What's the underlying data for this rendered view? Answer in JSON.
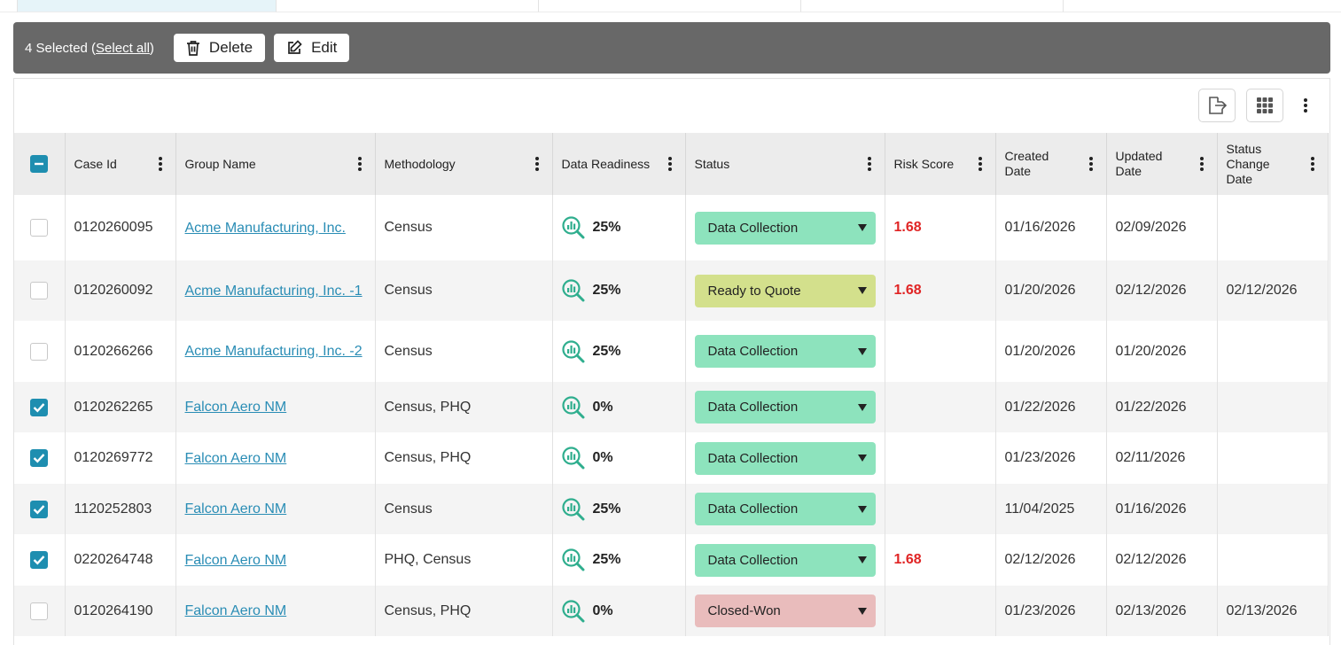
{
  "selection_bar": {
    "count_text": "4 Selected (",
    "select_all_label": "Select all",
    "close_paren": ")",
    "delete_label": "Delete",
    "edit_label": "Edit"
  },
  "icons": {
    "export": "export-icon",
    "columns": "grid-icon",
    "more": "kebab-icon"
  },
  "colors": {
    "selection_bar": "#686868",
    "checkbox_on": "#1e8eb0",
    "link": "#2a8db5",
    "risk": "#e02424",
    "status_data_collection": "#8de3bd",
    "status_ready_to_quote": "#d3e08c",
    "status_closed_won": "#e9bcbc"
  },
  "table": {
    "columns": [
      "Case Id",
      "Group Name",
      "Methodology",
      "Data Readiness",
      "Status",
      "Risk Score",
      "Created Date",
      "Updated Date",
      "Status Change Date"
    ],
    "rows": [
      {
        "checked": false,
        "case_id": "0120260095",
        "group": "Acme Manufacturing, Inc.",
        "methodology": "Census",
        "readiness": "25%",
        "status": "Data Collection",
        "risk": "1.68",
        "created": "01/16/2026",
        "updated": "02/09/2026",
        "status_change": ""
      },
      {
        "checked": false,
        "case_id": "0120260092",
        "group": "Acme Manufacturing, Inc. -1",
        "methodology": "Census",
        "readiness": "25%",
        "status": "Ready to Quote",
        "risk": "1.68",
        "created": "01/20/2026",
        "updated": "02/12/2026",
        "status_change": "02/12/2026"
      },
      {
        "checked": false,
        "case_id": "0120266266",
        "group": "Acme Manufacturing, Inc. -2",
        "methodology": "Census",
        "readiness": "25%",
        "status": "Data Collection",
        "risk": "",
        "created": "01/20/2026",
        "updated": "01/20/2026",
        "status_change": ""
      },
      {
        "checked": true,
        "case_id": "0120262265",
        "group": "Falcon Aero NM",
        "methodology": "Census, PHQ",
        "readiness": "0%",
        "status": "Data Collection",
        "risk": "",
        "created": "01/22/2026",
        "updated": "01/22/2026",
        "status_change": ""
      },
      {
        "checked": true,
        "case_id": "0120269772",
        "group": "Falcon Aero NM",
        "methodology": "Census, PHQ",
        "readiness": "0%",
        "status": "Data Collection",
        "risk": "",
        "created": "01/23/2026",
        "updated": "02/11/2026",
        "status_change": ""
      },
      {
        "checked": true,
        "case_id": "1120252803",
        "group": "Falcon Aero NM",
        "methodology": "Census",
        "readiness": "25%",
        "status": "Data Collection",
        "risk": "",
        "created": "11/04/2025",
        "updated": "01/16/2026",
        "status_change": ""
      },
      {
        "checked": true,
        "case_id": "0220264748",
        "group": "Falcon Aero NM",
        "methodology": "PHQ, Census",
        "readiness": "25%",
        "status": "Data Collection",
        "risk": "1.68",
        "created": "02/12/2026",
        "updated": "02/12/2026",
        "status_change": ""
      },
      {
        "checked": false,
        "case_id": "0120264190",
        "group": "Falcon Aero NM",
        "methodology": "Census, PHQ",
        "readiness": "0%",
        "status": "Closed-Won",
        "risk": "",
        "created": "01/23/2026",
        "updated": "02/13/2026",
        "status_change": "02/13/2026"
      }
    ]
  }
}
